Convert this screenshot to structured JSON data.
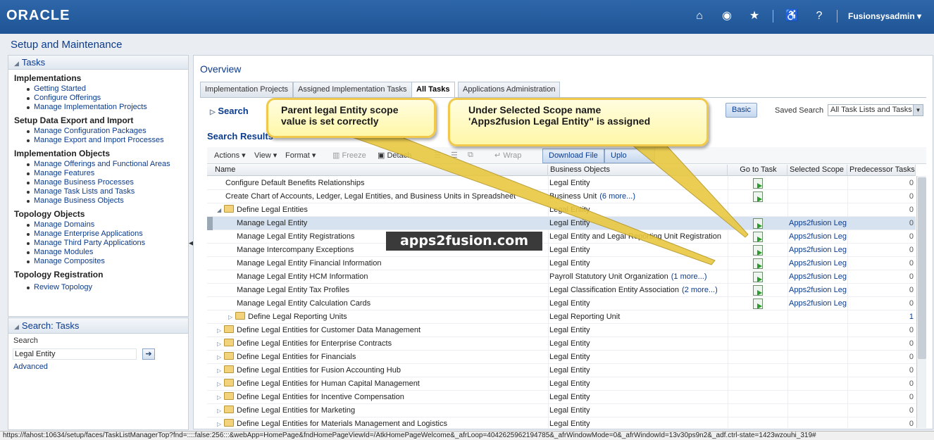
{
  "header": {
    "logo": "ORACLE",
    "user": "Fusionsysadmin"
  },
  "page_title": "Setup and Maintenance",
  "tasks_panel": {
    "title": "Tasks",
    "sections": [
      {
        "title": "Implementations",
        "links": [
          "Getting Started",
          "Configure Offerings",
          "Manage Implementation Projects"
        ]
      },
      {
        "title": "Setup Data Export and Import",
        "links": [
          "Manage Configuration Packages",
          "Manage Export and Import Processes"
        ]
      },
      {
        "title": "Implementation Objects",
        "links": [
          "Manage Offerings and Functional Areas",
          "Manage Features",
          "Manage Business Processes",
          "Manage Task Lists and Tasks",
          "Manage Business Objects"
        ]
      },
      {
        "title": "Topology Objects",
        "links": [
          "Manage Domains",
          "Manage Enterprise Applications",
          "Manage Third Party Applications",
          "Manage Modules",
          "Manage Composites"
        ]
      },
      {
        "title": "Topology Registration",
        "links": [
          "Review Topology"
        ]
      }
    ]
  },
  "search_panel": {
    "title": "Search: Tasks",
    "label": "Search",
    "value": "Legal Entity",
    "advanced": "Advanced"
  },
  "overview": {
    "title": "Overview",
    "tabs": [
      "Implementation Projects",
      "Assigned Implementation Tasks",
      "All Tasks",
      "Applications Administration"
    ],
    "search_label": "Search",
    "basic_button": "Basic",
    "saved_search_label": "Saved Search",
    "saved_search_value": "All Task Lists and Tasks",
    "results_title": "Search Results"
  },
  "toolbar": {
    "actions": "Actions",
    "view": "View",
    "format": "Format",
    "freeze": "Freeze",
    "detach": "Detach",
    "wrap": "Wrap",
    "download": "Download File",
    "upload": "Uplo"
  },
  "table": {
    "columns": [
      "Name",
      "Business Objects",
      "Go to Task",
      "Selected Scope",
      "Predecessor Tasks"
    ],
    "rows": [
      {
        "name": "Configure Default Benefits Relationships",
        "bo": "Legal Entity",
        "more": "",
        "go": true,
        "scope": "",
        "pred": "0"
      },
      {
        "name": "Create Chart of Accounts, Ledger, Legal Entities, and Business Units in Spreadsheet",
        "bo": "Business Unit",
        "more": "(6 more...)",
        "go": true,
        "scope": "",
        "pred": "0"
      },
      {
        "name": "Define Legal Entities",
        "bo": "Legal Entity",
        "more": "",
        "go": false,
        "scope": "",
        "pred": "0"
      },
      {
        "name": "Manage Legal Entity",
        "bo": "Legal Entity",
        "more": "",
        "go": true,
        "scope": "Apps2fusion Lega",
        "pred": "0"
      },
      {
        "name": "Manage Legal Entity Registrations",
        "bo": "Legal Entity and Legal Reporting Unit Registration",
        "more": "",
        "go": true,
        "scope": "Apps2fusion Lega",
        "pred": "0"
      },
      {
        "name": "Manage Intercompany Exceptions",
        "bo": "Legal Entity",
        "more": "",
        "go": true,
        "scope": "Apps2fusion Lega",
        "pred": "0"
      },
      {
        "name": "Manage Legal Entity Financial Information",
        "bo": "Legal Entity",
        "more": "",
        "go": true,
        "scope": "Apps2fusion Lega",
        "pred": "0"
      },
      {
        "name": "Manage Legal Entity HCM Information",
        "bo": "Payroll Statutory Unit Organization",
        "more": "(1 more...)",
        "go": true,
        "scope": "Apps2fusion Lega",
        "pred": "0"
      },
      {
        "name": "Manage Legal Entity Tax Profiles",
        "bo": "Legal Classification Entity Association",
        "more": "(2 more...)",
        "go": true,
        "scope": "Apps2fusion Lega",
        "pred": "0"
      },
      {
        "name": "Manage Legal Entity Calculation Cards",
        "bo": "Legal Entity",
        "more": "",
        "go": true,
        "scope": "Apps2fusion Lega",
        "pred": "0"
      },
      {
        "name": "Define Legal Reporting Units",
        "bo": "Legal Reporting Unit",
        "more": "",
        "go": false,
        "scope": "",
        "pred": "1"
      },
      {
        "name": "Define Legal Entities for Customer Data Management",
        "bo": "Legal Entity",
        "more": "",
        "go": false,
        "scope": "",
        "pred": "0"
      },
      {
        "name": "Define Legal Entities for Enterprise Contracts",
        "bo": "Legal Entity",
        "more": "",
        "go": false,
        "scope": "",
        "pred": "0"
      },
      {
        "name": "Define Legal Entities for Financials",
        "bo": "Legal Entity",
        "more": "",
        "go": false,
        "scope": "",
        "pred": "0"
      },
      {
        "name": "Define Legal Entities for Fusion Accounting Hub",
        "bo": "Legal Entity",
        "more": "",
        "go": false,
        "scope": "",
        "pred": "0"
      },
      {
        "name": "Define Legal Entities for Human Capital Management",
        "bo": "Legal Entity",
        "more": "",
        "go": false,
        "scope": "",
        "pred": "0"
      },
      {
        "name": "Define Legal Entities for Incentive Compensation",
        "bo": "Legal Entity",
        "more": "",
        "go": false,
        "scope": "",
        "pred": "0"
      },
      {
        "name": "Define Legal Entities for Marketing",
        "bo": "Legal Entity",
        "more": "",
        "go": false,
        "scope": "",
        "pred": "0"
      },
      {
        "name": "Define Legal Entities for Materials Management and Logistics",
        "bo": "Legal Entity",
        "more": "",
        "go": false,
        "scope": "",
        "pred": "0"
      }
    ]
  },
  "callouts": {
    "left": "Parent legal Entity scope value is set correctly",
    "right_line1": "Under Selected Scope name",
    "right_line2": "'Apps2fusion Legal Entity\" is assigned"
  },
  "watermark": "apps2fusion.com",
  "status_bar": "https://fahost:10634/setup/faces/TaskListManagerTop?fnd=::::false:256:::&webApp=HomePage&fndHomePageViewId=/AtkHomePageWelcome&_afrLoop=4042625962194785&_afrWindowMode=0&_afrWindowId=13v30ps9n2&_adf.ctrl-state=1423wzouhi_319#"
}
